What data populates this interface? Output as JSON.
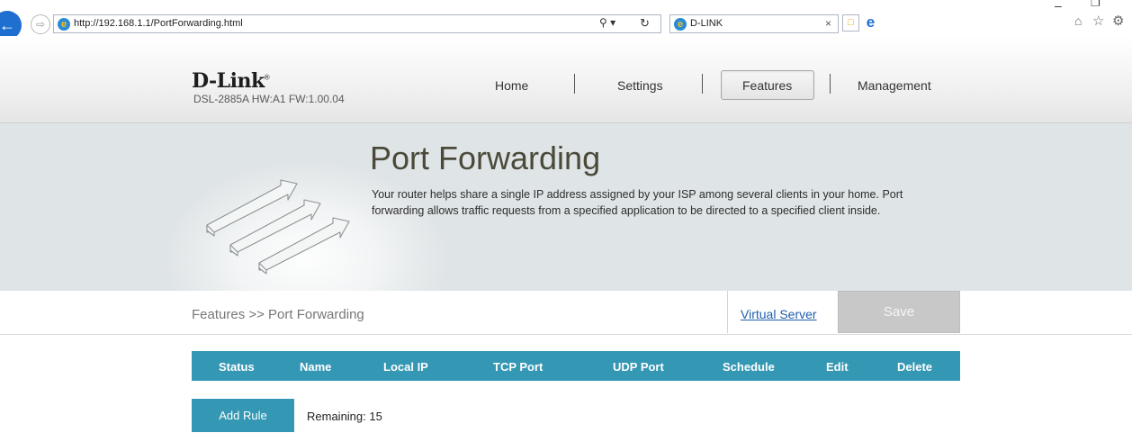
{
  "browser": {
    "url": "http://192.168.1.1/PortForwarding.html",
    "tab_title": "D-LINK"
  },
  "header": {
    "logo_text": "D-Link",
    "logo_mark": "®",
    "model_info": "DSL-2885A   HW:A1   FW:1.00.04",
    "nav": [
      "Home",
      "Settings",
      "Features",
      "Management"
    ],
    "active_nav": "Features"
  },
  "hero": {
    "title": "Port Forwarding",
    "description": "Your router helps share a single IP address assigned by your ISP among several clients in your home. Port forwarding allows traffic requests from a specified application to be directed to a specified client inside."
  },
  "breadcrumb": {
    "text": "Features >> Port Forwarding",
    "virtual_server_link": "Virtual Server",
    "save_label": "Save"
  },
  "table": {
    "columns": [
      "Status",
      "Name",
      "Local IP",
      "TCP Port",
      "UDP Port",
      "Schedule",
      "Edit",
      "Delete"
    ]
  },
  "actions": {
    "add_rule_label": "Add Rule",
    "remaining_label": "Remaining: 15"
  },
  "colors": {
    "accent": "#3497b3",
    "link": "#1f5eab",
    "save_disabled": "#c8c8c8"
  }
}
